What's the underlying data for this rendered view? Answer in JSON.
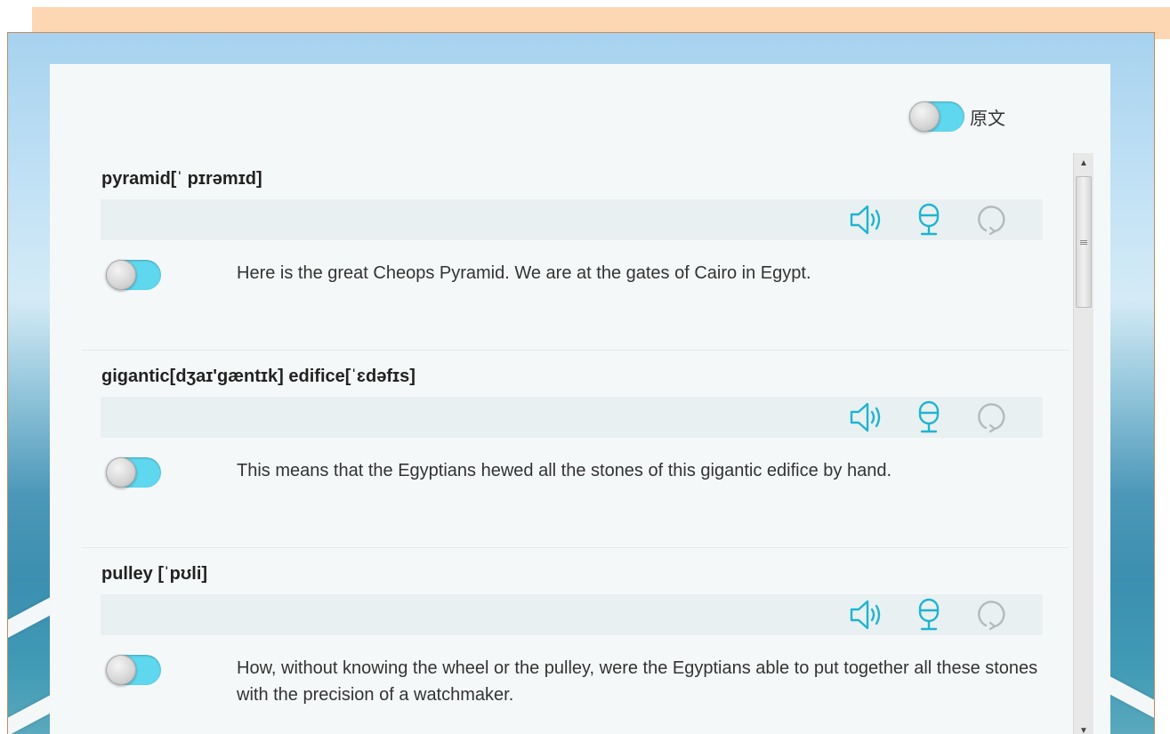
{
  "top": {
    "toggle_label": "原文"
  },
  "colors": {
    "accent": "#1fb4cf",
    "toggle_on": "#5fd8ef",
    "panel_bg": "#f5f8f9",
    "strip_bg": "#e9f0f2",
    "peach": "#fdd6b3"
  },
  "items": [
    {
      "title": "pyramid[ˈ pɪrəmɪd]",
      "sentence": "Here is the great Cheops Pyramid. We are at the gates of Cairo in Egypt.",
      "icons": [
        "speaker-icon",
        "microphone-icon",
        "replay-icon"
      ]
    },
    {
      "title": "gigantic[dʒaɪ'gæntɪk] edifice[ˈɛdəfɪs]",
      "sentence": "This means that the Egyptians hewed all the stones of this gigantic edifice by hand.",
      "icons": [
        "speaker-icon",
        "microphone-icon",
        "replay-icon"
      ]
    },
    {
      "title": "pulley [ˈpʊli]",
      "sentence": "How, without knowing the wheel or the pulley, were the Egyptians able to put together all these stones with the precision of a watchmaker.",
      "icons": [
        "speaker-icon",
        "microphone-icon",
        "replay-icon"
      ]
    }
  ]
}
